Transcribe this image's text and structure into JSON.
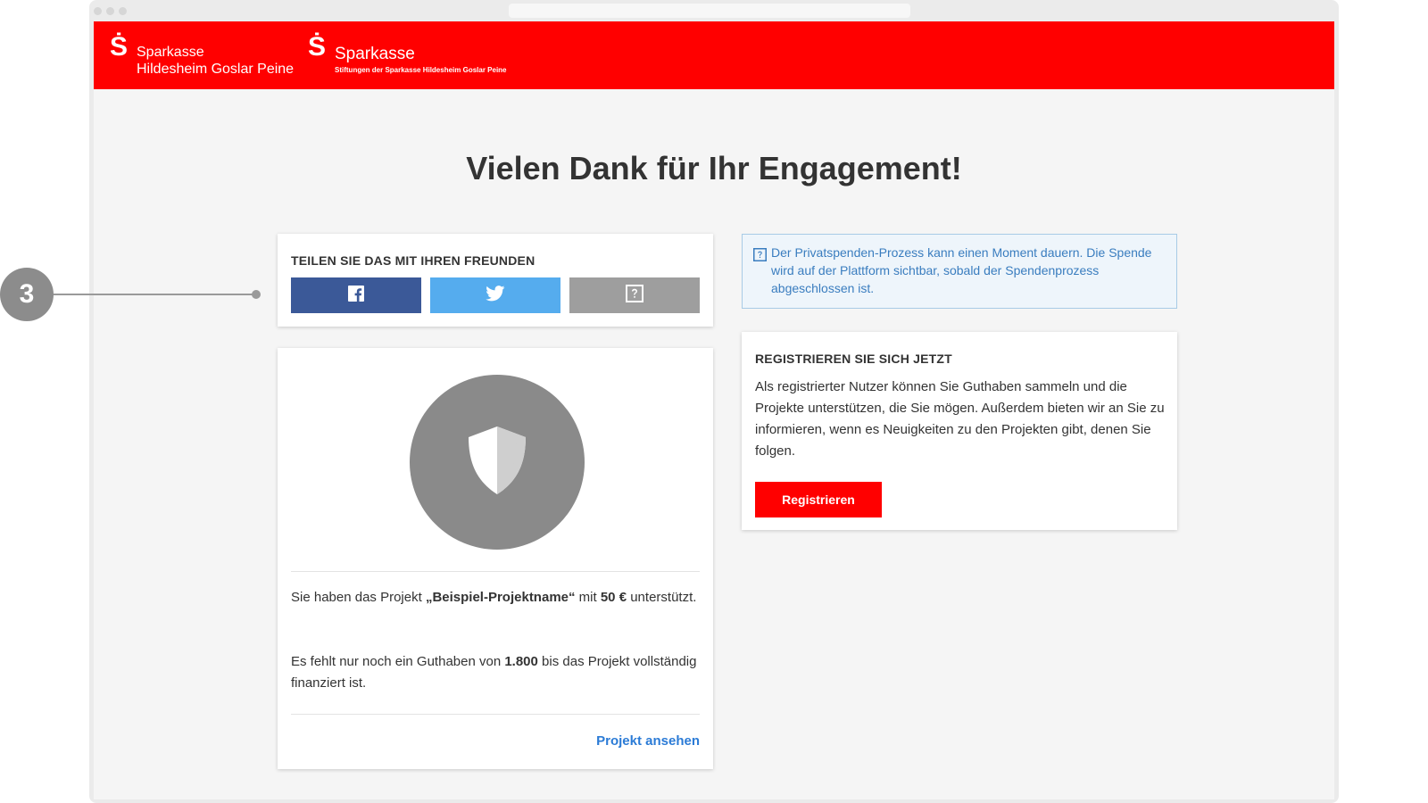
{
  "header": {
    "logo_primary": {
      "symbol": "Ṡ",
      "line1": "Sparkasse",
      "line2": "Hildesheim Goslar Peine"
    },
    "logo_secondary": {
      "symbol": "Ṡ",
      "line1": "Sparkasse",
      "line2": "Stiftungen der Sparkasse Hildesheim Goslar Peine"
    }
  },
  "page": {
    "title": "Vielen Dank für Ihr Engagement!"
  },
  "share": {
    "heading": "TEILEN SIE DAS MIT IHREN FREUNDEN",
    "buttons": [
      {
        "icon": "facebook-icon"
      },
      {
        "icon": "twitter-icon"
      },
      {
        "icon": "help-icon"
      }
    ]
  },
  "project": {
    "icon": "shield-icon",
    "text1_pre": "Sie haben das Projekt ",
    "project_name": "„Beispiel-Projektname“",
    "text1_mid": " mit ",
    "amount": "50 €",
    "text1_post": " unterstützt.",
    "text2_pre": "Es fehlt nur noch ein Guthaben von ",
    "remaining": "1.800",
    "text2_post": " bis das Projekt vollständig finanziert ist.",
    "link_label": "Projekt ansehen"
  },
  "info": {
    "icon": "help-icon",
    "text": "Der Privatspenden-Prozess kann einen Moment dauern. Die Spende wird auf der Plattform sichtbar, sobald der Spendenprozess abgeschlossen ist."
  },
  "register": {
    "heading": "REGISTRIEREN SIE SICH JETZT",
    "text": "Als registrierter Nutzer können Sie Guthaben sammeln und die Projekte unterstützen, die Sie mögen. Außerdem bieten wir an Sie zu informieren, wenn es Neuigkeiten zu den Projekten gibt, denen Sie folgen.",
    "button_label": "Registrieren"
  },
  "annotation": {
    "number": "3"
  },
  "colors": {
    "brand_red": "#ff0000",
    "facebook": "#3b5998",
    "twitter": "#55acee",
    "link_blue": "#2b7bd6"
  }
}
